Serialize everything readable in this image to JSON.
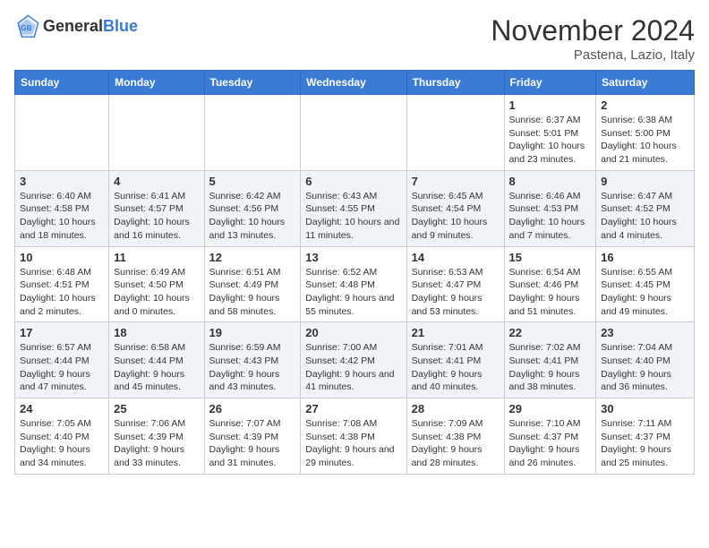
{
  "header": {
    "logo_general": "General",
    "logo_blue": "Blue",
    "title": "November 2024",
    "location": "Pastena, Lazio, Italy"
  },
  "days_of_week": [
    "Sunday",
    "Monday",
    "Tuesday",
    "Wednesday",
    "Thursday",
    "Friday",
    "Saturday"
  ],
  "weeks": [
    [
      {
        "day": "",
        "info": ""
      },
      {
        "day": "",
        "info": ""
      },
      {
        "day": "",
        "info": ""
      },
      {
        "day": "",
        "info": ""
      },
      {
        "day": "",
        "info": ""
      },
      {
        "day": "1",
        "info": "Sunrise: 6:37 AM\nSunset: 5:01 PM\nDaylight: 10 hours and 23 minutes."
      },
      {
        "day": "2",
        "info": "Sunrise: 6:38 AM\nSunset: 5:00 PM\nDaylight: 10 hours and 21 minutes."
      }
    ],
    [
      {
        "day": "3",
        "info": "Sunrise: 6:40 AM\nSunset: 4:58 PM\nDaylight: 10 hours and 18 minutes."
      },
      {
        "day": "4",
        "info": "Sunrise: 6:41 AM\nSunset: 4:57 PM\nDaylight: 10 hours and 16 minutes."
      },
      {
        "day": "5",
        "info": "Sunrise: 6:42 AM\nSunset: 4:56 PM\nDaylight: 10 hours and 13 minutes."
      },
      {
        "day": "6",
        "info": "Sunrise: 6:43 AM\nSunset: 4:55 PM\nDaylight: 10 hours and 11 minutes."
      },
      {
        "day": "7",
        "info": "Sunrise: 6:45 AM\nSunset: 4:54 PM\nDaylight: 10 hours and 9 minutes."
      },
      {
        "day": "8",
        "info": "Sunrise: 6:46 AM\nSunset: 4:53 PM\nDaylight: 10 hours and 7 minutes."
      },
      {
        "day": "9",
        "info": "Sunrise: 6:47 AM\nSunset: 4:52 PM\nDaylight: 10 hours and 4 minutes."
      }
    ],
    [
      {
        "day": "10",
        "info": "Sunrise: 6:48 AM\nSunset: 4:51 PM\nDaylight: 10 hours and 2 minutes."
      },
      {
        "day": "11",
        "info": "Sunrise: 6:49 AM\nSunset: 4:50 PM\nDaylight: 10 hours and 0 minutes."
      },
      {
        "day": "12",
        "info": "Sunrise: 6:51 AM\nSunset: 4:49 PM\nDaylight: 9 hours and 58 minutes."
      },
      {
        "day": "13",
        "info": "Sunrise: 6:52 AM\nSunset: 4:48 PM\nDaylight: 9 hours and 55 minutes."
      },
      {
        "day": "14",
        "info": "Sunrise: 6:53 AM\nSunset: 4:47 PM\nDaylight: 9 hours and 53 minutes."
      },
      {
        "day": "15",
        "info": "Sunrise: 6:54 AM\nSunset: 4:46 PM\nDaylight: 9 hours and 51 minutes."
      },
      {
        "day": "16",
        "info": "Sunrise: 6:55 AM\nSunset: 4:45 PM\nDaylight: 9 hours and 49 minutes."
      }
    ],
    [
      {
        "day": "17",
        "info": "Sunrise: 6:57 AM\nSunset: 4:44 PM\nDaylight: 9 hours and 47 minutes."
      },
      {
        "day": "18",
        "info": "Sunrise: 6:58 AM\nSunset: 4:44 PM\nDaylight: 9 hours and 45 minutes."
      },
      {
        "day": "19",
        "info": "Sunrise: 6:59 AM\nSunset: 4:43 PM\nDaylight: 9 hours and 43 minutes."
      },
      {
        "day": "20",
        "info": "Sunrise: 7:00 AM\nSunset: 4:42 PM\nDaylight: 9 hours and 41 minutes."
      },
      {
        "day": "21",
        "info": "Sunrise: 7:01 AM\nSunset: 4:41 PM\nDaylight: 9 hours and 40 minutes."
      },
      {
        "day": "22",
        "info": "Sunrise: 7:02 AM\nSunset: 4:41 PM\nDaylight: 9 hours and 38 minutes."
      },
      {
        "day": "23",
        "info": "Sunrise: 7:04 AM\nSunset: 4:40 PM\nDaylight: 9 hours and 36 minutes."
      }
    ],
    [
      {
        "day": "24",
        "info": "Sunrise: 7:05 AM\nSunset: 4:40 PM\nDaylight: 9 hours and 34 minutes."
      },
      {
        "day": "25",
        "info": "Sunrise: 7:06 AM\nSunset: 4:39 PM\nDaylight: 9 hours and 33 minutes."
      },
      {
        "day": "26",
        "info": "Sunrise: 7:07 AM\nSunset: 4:39 PM\nDaylight: 9 hours and 31 minutes."
      },
      {
        "day": "27",
        "info": "Sunrise: 7:08 AM\nSunset: 4:38 PM\nDaylight: 9 hours and 29 minutes."
      },
      {
        "day": "28",
        "info": "Sunrise: 7:09 AM\nSunset: 4:38 PM\nDaylight: 9 hours and 28 minutes."
      },
      {
        "day": "29",
        "info": "Sunrise: 7:10 AM\nSunset: 4:37 PM\nDaylight: 9 hours and 26 minutes."
      },
      {
        "day": "30",
        "info": "Sunrise: 7:11 AM\nSunset: 4:37 PM\nDaylight: 9 hours and 25 minutes."
      }
    ]
  ]
}
